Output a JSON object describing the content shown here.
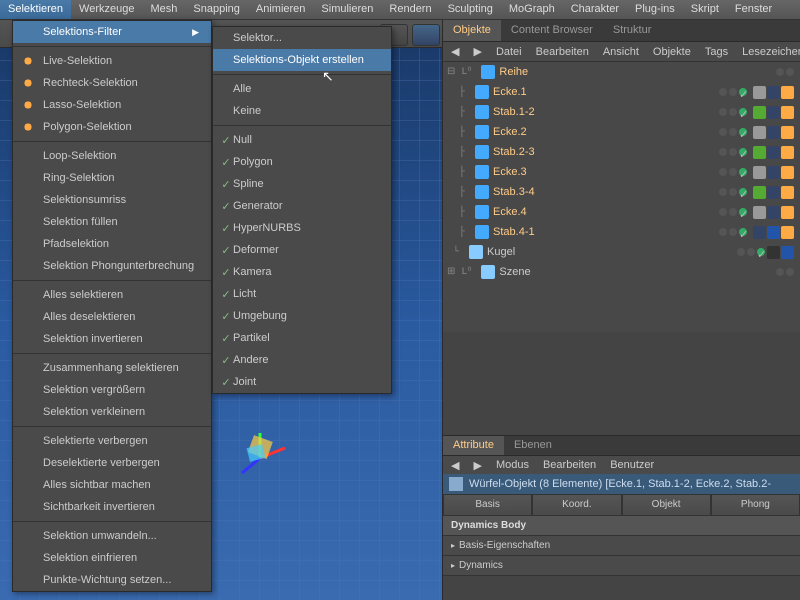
{
  "menubar": [
    "Selektieren",
    "Werkzeuge",
    "Mesh",
    "Snapping",
    "Animieren",
    "Simulieren",
    "Rendern",
    "Sculpting",
    "MoGraph",
    "Charakter",
    "Plug-ins",
    "Skript",
    "Fenster"
  ],
  "submenu1": {
    "filter": "Selektions-Filter",
    "groups": [
      [
        "Live-Selektion",
        "Rechteck-Selektion",
        "Lasso-Selektion",
        "Polygon-Selektion"
      ],
      [
        "Loop-Selektion",
        "Ring-Selektion",
        "Selektionsumriss",
        "Selektion füllen",
        "Pfadselektion",
        "Selektion Phongunterbrechung"
      ],
      [
        "Alles selektieren",
        "Alles deselektieren",
        "Selektion invertieren"
      ],
      [
        "Zusammenhang selektieren",
        "Selektion vergrößern",
        "Selektion verkleinern"
      ],
      [
        "Selektierte verbergen",
        "Deselektierte verbergen",
        "Alles sichtbar machen",
        "Sichtbarkeit invertieren"
      ],
      [
        "Selektion umwandeln...",
        "Selektion einfrieren",
        "Punkte-Wichtung setzen..."
      ]
    ]
  },
  "submenu2": {
    "top": [
      "Selektor...",
      "Selektions-Objekt erstellen"
    ],
    "mid": [
      "Alle",
      "Keine"
    ],
    "checks": [
      "Null",
      "Polygon",
      "Spline",
      "Generator",
      "HyperNURBS",
      "Deformer",
      "Kamera",
      "Licht",
      "Umgebung",
      "Partikel",
      "Andere",
      "Joint"
    ]
  },
  "rtabs": [
    "Objekte",
    "Content Browser",
    "Struktur"
  ],
  "objbar": [
    "Datei",
    "Bearbeiten",
    "Ansicht",
    "Objekte",
    "Tags",
    "Lesezeichen"
  ],
  "objects": {
    "root": "Reihe",
    "children": [
      "Ecke.1",
      "Stab.1-2",
      "Ecke.2",
      "Stab.2-3",
      "Ecke.3",
      "Stab.3-4",
      "Ecke.4",
      "Stab.4-1"
    ],
    "kugel": "Kugel",
    "szene": "Szene"
  },
  "attr": {
    "tabs": [
      "Attribute",
      "Ebenen"
    ],
    "bar": [
      "Modus",
      "Bearbeiten",
      "Benutzer"
    ],
    "title": "Würfel-Objekt (8 Elemente) [Ecke.1, Stab.1-2, Ecke.2, Stab.2-",
    "btns": [
      "Basis",
      "Koord.",
      "Objekt",
      "Phong"
    ],
    "body": "Dynamics Body",
    "rows": [
      "Basis-Eigenschaften",
      "Dynamics"
    ]
  }
}
